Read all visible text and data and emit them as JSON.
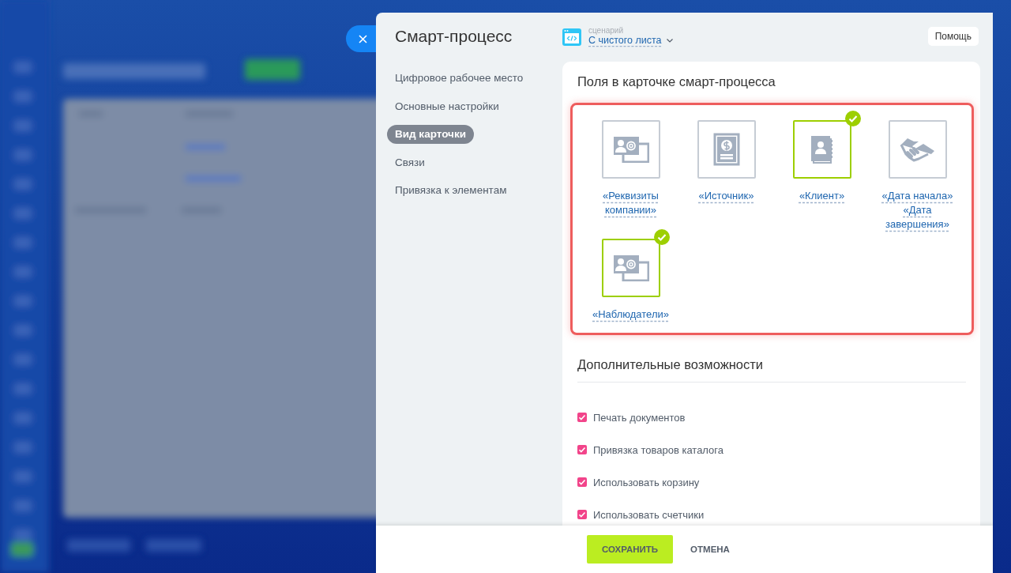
{
  "title": "Смарт-процесс",
  "nav": [
    {
      "label": "Цифровое рабочее место",
      "selected": false
    },
    {
      "label": "Основные настройки",
      "selected": false
    },
    {
      "label": "Вид карточки",
      "selected": true
    },
    {
      "label": "Связи",
      "selected": false
    },
    {
      "label": "Привязка к элементам",
      "selected": false
    }
  ],
  "scenario": {
    "caption": "сценарий",
    "value": "С чистого листа"
  },
  "help_button": "Помощь",
  "fields_section": {
    "title": "Поля в карточке смарт-процесса",
    "fields": [
      {
        "label": "«Реквизиты компании»",
        "kind": "requisites",
        "selected": false
      },
      {
        "label": "«Источник»",
        "kind": "source",
        "selected": false
      },
      {
        "label": "«Клиент»",
        "kind": "client",
        "selected": true
      },
      {
        "label": "«Дата начала» «Дата завершения»",
        "kind": "dates",
        "selected": false
      },
      {
        "label": "«Наблюдатели»",
        "kind": "requisites",
        "selected": true
      }
    ]
  },
  "extras": {
    "title": "Дополнительные возможности",
    "options": [
      {
        "label": "Печать документов",
        "checked": true
      },
      {
        "label": "Привязка товаров каталога",
        "checked": true
      },
      {
        "label": "Использовать корзину",
        "checked": true
      },
      {
        "label": "Использовать счетчики",
        "checked": true
      }
    ]
  },
  "buttons": {
    "save": "СОХРАНИТЬ",
    "cancel": "ОТМЕНА"
  }
}
